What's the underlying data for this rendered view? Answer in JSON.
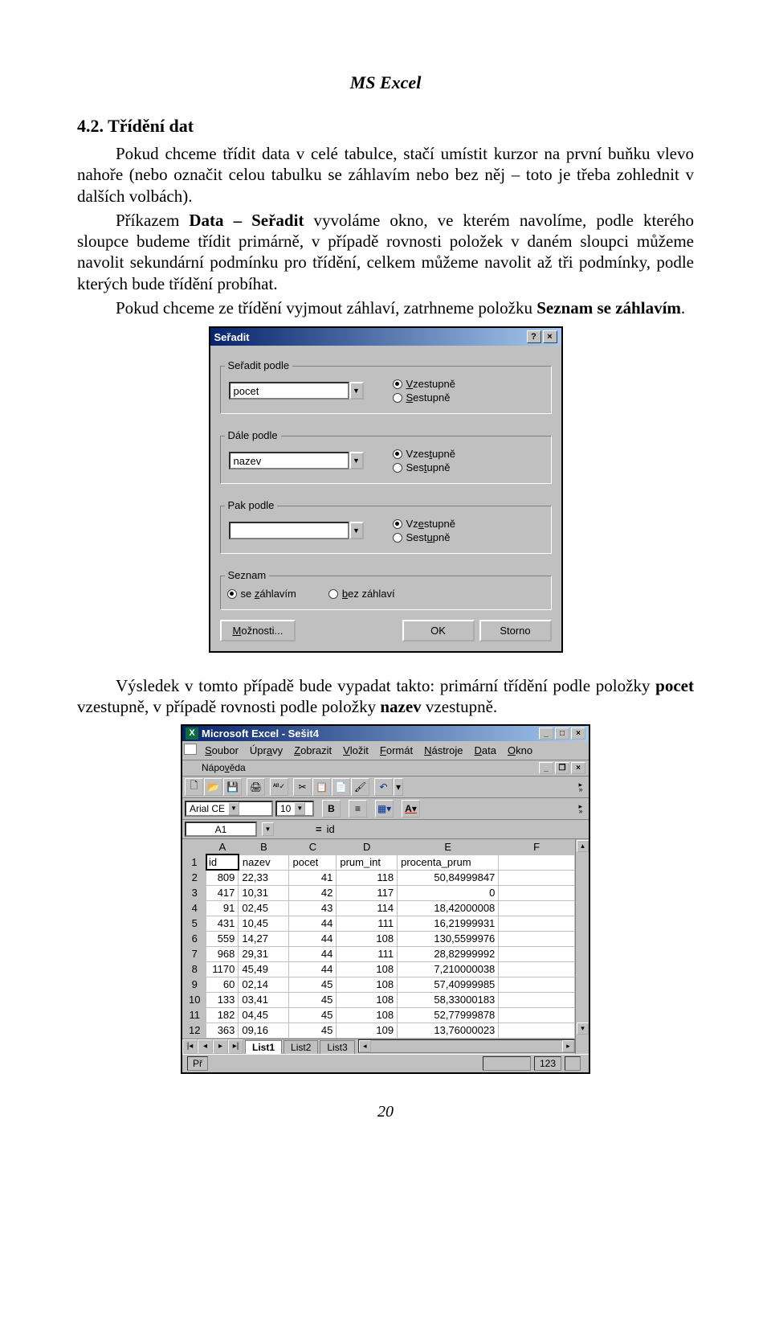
{
  "header": "MS Excel",
  "sectionTitle": "4.2. Třídění dat",
  "paragraphs": {
    "p1": "Pokud chceme třídit data v celé tabulce, stačí umístit kurzor na první buňku vlevo nahoře (nebo označit celou tabulku se záhlavím nebo bez něj – toto je třeba zohlednit v dalších volbách).",
    "p2a": "Příkazem ",
    "p2b": "Data – Seřadit",
    "p2c": " vyvoláme okno, ve kterém navolíme, podle kterého sloupce budeme třídit primárně, v případě rovnosti položek v daném sloupci můžeme navolit sekundární podmínku pro třídění, celkem můžeme navolit až tři podmínky, podle kterých bude třídění probíhat.",
    "p3a": "Pokud chceme ze třídění vyjmout záhlaví, zatrhneme položku ",
    "p3b": "Seznam se záhlavím",
    "p3c": ".",
    "p4a": "Výsledek v tomto případě bude vypadat takto: primární třídění podle položky ",
    "p4b": "pocet",
    "p4c": " vzestupně, v případě rovnosti podle položky ",
    "p4d": "nazev",
    "p4e": " vzestupně."
  },
  "dialog": {
    "title": "Seřadit",
    "group1": {
      "label": "Seřadit podle",
      "combo": "pocet"
    },
    "group2": {
      "label": "Dále podle",
      "combo": "nazev"
    },
    "group3": {
      "label": "Pak podle",
      "combo": ""
    },
    "asc": "Vzestupně",
    "desc": "Sestupně",
    "list": {
      "label": "Seznam",
      "withHeader": "se záhlavím",
      "noHeader": "bez záhlaví"
    },
    "buttons": {
      "options": "Možnosti...",
      "ok": "OK",
      "cancel": "Storno"
    }
  },
  "excel": {
    "title": "Microsoft Excel - Sešit4",
    "menus": {
      "soubor": "Soubor",
      "upravy": "Úpravy",
      "zobrazit": "Zobrazit",
      "vlozit": "Vložit",
      "format": "Formát",
      "nastroje": "Nástroje",
      "data": "Data",
      "okno": "Okno",
      "napoveda": "Nápověda"
    },
    "font": "Arial CE",
    "size": "10",
    "namebox": "A1",
    "formula": "id",
    "columns": [
      "A",
      "B",
      "C",
      "D",
      "E",
      "F"
    ],
    "headerRow": {
      "A": "id",
      "B": "nazev",
      "C": "pocet",
      "D": "prum_int",
      "E": "procenta_prum",
      "F": ""
    },
    "rows": [
      {
        "n": "2",
        "A": "809",
        "B": "22,33",
        "C": "41",
        "D": "118",
        "E": "50,84999847",
        "F": ""
      },
      {
        "n": "3",
        "A": "417",
        "B": "10,31",
        "C": "42",
        "D": "117",
        "E": "0",
        "F": ""
      },
      {
        "n": "4",
        "A": "91",
        "B": "02,45",
        "C": "43",
        "D": "114",
        "E": "18,42000008",
        "F": ""
      },
      {
        "n": "5",
        "A": "431",
        "B": "10,45",
        "C": "44",
        "D": "111",
        "E": "16,21999931",
        "F": ""
      },
      {
        "n": "6",
        "A": "559",
        "B": "14,27",
        "C": "44",
        "D": "108",
        "E": "130,5599976",
        "F": ""
      },
      {
        "n": "7",
        "A": "968",
        "B": "29,31",
        "C": "44",
        "D": "111",
        "E": "28,82999992",
        "F": ""
      },
      {
        "n": "8",
        "A": "1170",
        "B": "45,49",
        "C": "44",
        "D": "108",
        "E": "7,210000038",
        "F": ""
      },
      {
        "n": "9",
        "A": "60",
        "B": "02,14",
        "C": "45",
        "D": "108",
        "E": "57,40999985",
        "F": ""
      },
      {
        "n": "10",
        "A": "133",
        "B": "03,41",
        "C": "45",
        "D": "108",
        "E": "58,33000183",
        "F": ""
      },
      {
        "n": "11",
        "A": "182",
        "B": "04,45",
        "C": "45",
        "D": "108",
        "E": "52,77999878",
        "F": ""
      },
      {
        "n": "12",
        "A": "363",
        "B": "09,16",
        "C": "45",
        "D": "109",
        "E": "13,76000023",
        "F": ""
      }
    ],
    "sheets": {
      "s1": "List1",
      "s2": "List2",
      "s3": "List3"
    },
    "status": {
      "ready": "Př",
      "num": "123"
    }
  },
  "pageNum": "20"
}
